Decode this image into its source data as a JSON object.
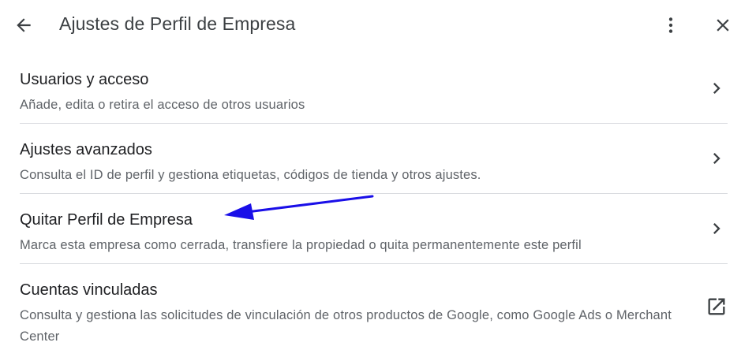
{
  "header": {
    "title": "Ajustes de Perfil de Empresa",
    "back_icon": "arrow-back-icon",
    "more_icon": "more-vert-icon",
    "close_icon": "close-icon"
  },
  "settings": {
    "items": [
      {
        "title": "Usuarios y acceso",
        "description": "Añade, edita o retira el acceso de otros usuarios",
        "icon": "chevron-right-icon"
      },
      {
        "title": "Ajustes avanzados",
        "description": "Consulta el ID de perfil y gestiona etiquetas, códigos de tienda y otros ajustes.",
        "icon": "chevron-right-icon"
      },
      {
        "title": "Quitar Perfil de Empresa",
        "description": "Marca esta empresa como cerrada, transfiere la propiedad o quita permanentemente este perfil",
        "icon": "chevron-right-icon"
      },
      {
        "title": "Cuentas vinculadas",
        "description": "Consulta y gestiona las solicitudes de vinculación de otros productos de Google, como Google Ads o Merchant Center",
        "icon": "open-in-new-icon"
      }
    ]
  },
  "annotation": {
    "color": "#1a0fe8",
    "target": "Quitar Perfil de Empresa"
  },
  "colors": {
    "text_primary": "#202124",
    "text_secondary": "#5f6368",
    "divider": "#dadce0",
    "icon": "#3c4043"
  }
}
